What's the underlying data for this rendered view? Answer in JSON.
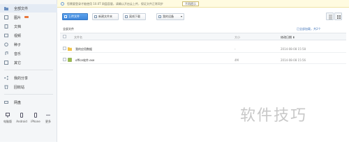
{
  "sidebar": {
    "items": [
      {
        "label": "全部文件",
        "icon": "folder-icon"
      },
      {
        "label": "图片",
        "icon": "picture-icon"
      },
      {
        "label": "文档",
        "icon": "document-icon"
      },
      {
        "label": "视频",
        "icon": "video-icon"
      },
      {
        "label": "种子",
        "icon": "torrent-icon"
      },
      {
        "label": "音乐",
        "icon": "music-icon"
      },
      {
        "label": "其它",
        "icon": "other-icon"
      },
      {
        "label": "我的分享",
        "icon": "share-icon"
      },
      {
        "label": "回收站",
        "icon": "recycle-bin-icon"
      },
      {
        "label": "网盘",
        "icon": "netdisk-icon"
      }
    ],
    "devices": [
      {
        "label": "电脑版",
        "icon": "computer-icon"
      },
      {
        "label": "Android",
        "icon": "android-icon"
      },
      {
        "label": "iPhone",
        "icon": "iphone-icon"
      },
      {
        "label": "更多",
        "icon": "more-icon"
      }
    ]
  },
  "notice": {
    "message": "您需要登录才能使用 10.0T 网盘容量，请确认开启云上传，保证文件正常同步",
    "button": "不再提示"
  },
  "toolbar": {
    "upload": "上传文件",
    "new_folder": "新建文件夹",
    "offline": "离线下载",
    "my_device": "我的设备"
  },
  "breadcrumb": {
    "current": "全部文件",
    "right_info": "已全部加载，共2个"
  },
  "table": {
    "columns": {
      "name": "文件名",
      "size": "大小",
      "date": "修改日期 ⬇"
    },
    "rows": [
      {
        "name": "我的应用数据",
        "size": "-",
        "date": "2014-08-08 15:58",
        "type": "folder"
      },
      {
        "name": "office软件.exe",
        "size": "4M",
        "date": "2014-08-08 15:56",
        "type": "exe"
      }
    ]
  },
  "watermark": "软件技巧",
  "colors": {
    "accent": "#3f86db",
    "notice_bg": "#fffbe0",
    "sidebar_bg": "#f4f6f8"
  }
}
